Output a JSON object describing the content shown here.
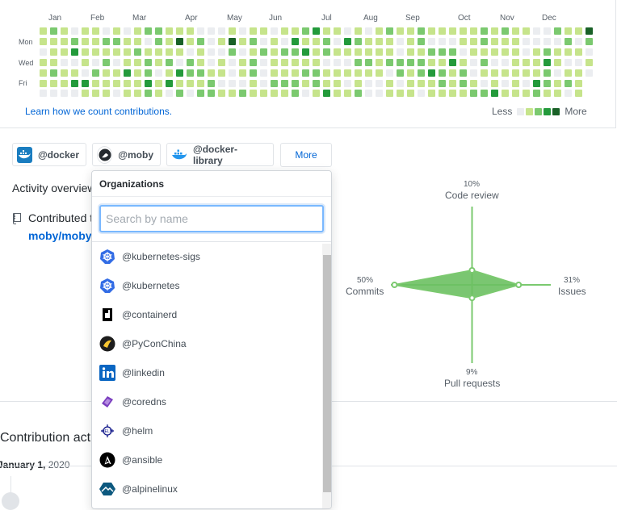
{
  "calendar": {
    "months": [
      "Jan",
      "Feb",
      "Mar",
      "Apr",
      "May",
      "Jun",
      "Jul",
      "Aug",
      "Sep",
      "Oct",
      "Nov",
      "Dec"
    ],
    "days": [
      "Mon",
      "Wed",
      "Fri"
    ],
    "learn_link": "Learn how we count contributions.",
    "legend_less": "Less",
    "legend_more": "More",
    "colors": [
      "#ebedf0",
      "#c6e48b",
      "#7bc96f",
      "#239a3b",
      "#196127"
    ]
  },
  "orgs": [
    {
      "label": "@docker",
      "color": "#1a7dc0"
    },
    {
      "label": "@moby",
      "color": "#24292e"
    },
    {
      "label": "@docker-library",
      "color": "#2496ed"
    }
  ],
  "more_label": "More",
  "activity": {
    "title": "Activity overview",
    "contributed": "Contributed t",
    "repo": "moby/moby"
  },
  "radar": {
    "code_review_pct": "10%",
    "code_review": "Code review",
    "commits_pct": "50%",
    "commits": "Commits",
    "issues_pct": "31%",
    "issues": "Issues",
    "pr_pct": "9%",
    "pr": "Pull requests",
    "values": {
      "code_review": 10,
      "commits": 50,
      "issues": 31,
      "pull_requests": 9
    }
  },
  "contribution_activity": {
    "title": "Contribution acti",
    "date": "January 1,",
    "year": "2020"
  },
  "dropdown": {
    "header": "Organizations",
    "search_placeholder": "Search by name",
    "search_value": "",
    "items": [
      {
        "label": "@kubernetes-sigs",
        "icon": "kubernetes-icon"
      },
      {
        "label": "@kubernetes",
        "icon": "kubernetes-icon"
      },
      {
        "label": "@containerd",
        "icon": "containerd-icon"
      },
      {
        "label": "@PyConChina",
        "icon": "pyconchina-icon"
      },
      {
        "label": "@linkedin",
        "icon": "linkedin-icon"
      },
      {
        "label": "@coredns",
        "icon": "coredns-icon"
      },
      {
        "label": "@helm",
        "icon": "helm-icon"
      },
      {
        "label": "@ansible",
        "icon": "ansible-icon"
      },
      {
        "label": "@alpinelinux",
        "icon": "alpinelinux-icon"
      }
    ]
  }
}
